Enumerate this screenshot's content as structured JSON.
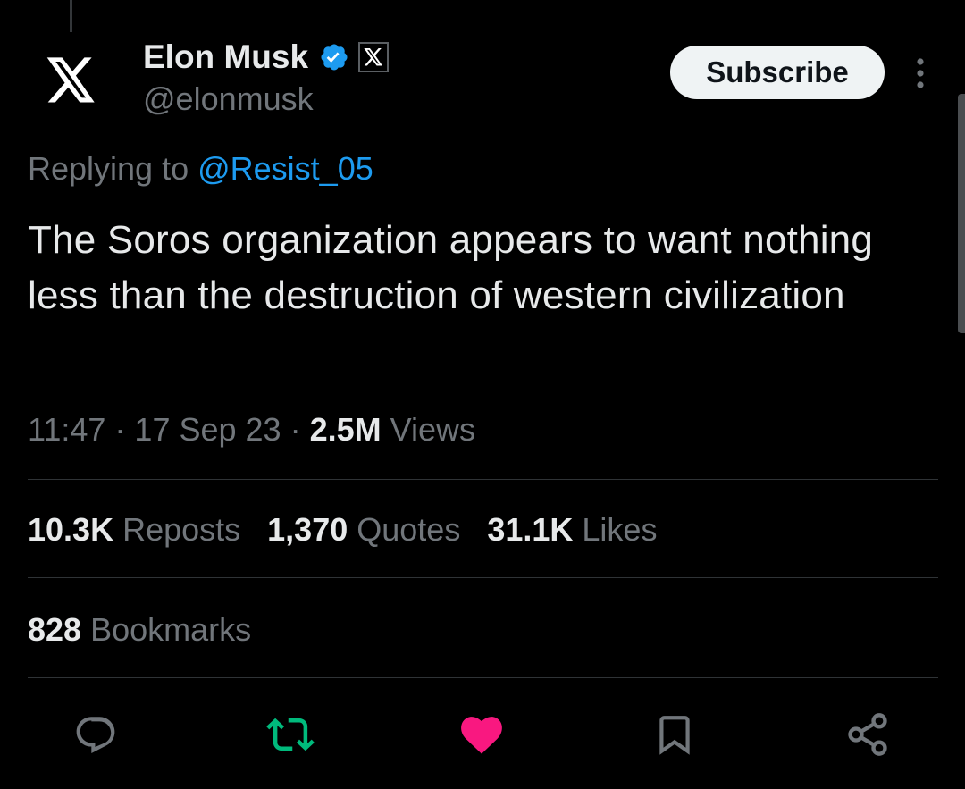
{
  "author": {
    "display_name": "Elon Musk",
    "handle": "@elonmusk",
    "avatar_icon": "x-logo-icon",
    "verified_color": "#1d9bf0",
    "affiliate_badge_icon": "x-logo-icon"
  },
  "header": {
    "subscribe_label": "Subscribe",
    "more_icon": "vertical-ellipsis-icon"
  },
  "reply": {
    "prefix": "Replying to ",
    "mention": "@Resist_05"
  },
  "tweet": {
    "text": "The Soros organization appears to want nothing less than the destruction of western civilization"
  },
  "meta": {
    "time": "11:47",
    "separator": " · ",
    "date": "17 Sep 23",
    "views_count": "2.5M",
    "views_label": " Views"
  },
  "stats": {
    "reposts_count": "10.3K",
    "reposts_label": " Reposts",
    "quotes_count": "1,370",
    "quotes_label": " Quotes",
    "likes_count": "31.1K",
    "likes_label": " Likes",
    "bookmarks_count": "828",
    "bookmarks_label": " Bookmarks"
  },
  "actions": {
    "reply_icon": "comment-icon",
    "repost_icon": "repost-icon",
    "repost_color": "#00ba7c",
    "like_icon": "heart-icon",
    "like_color": "#f91880",
    "bookmark_icon": "bookmark-icon",
    "share_icon": "share-icon",
    "icon_color": "#71767b"
  },
  "colors": {
    "background": "#000000",
    "text_primary": "#e7e9ea",
    "text_secondary": "#71767b",
    "link": "#1d9bf0",
    "divider": "#2f3336"
  }
}
